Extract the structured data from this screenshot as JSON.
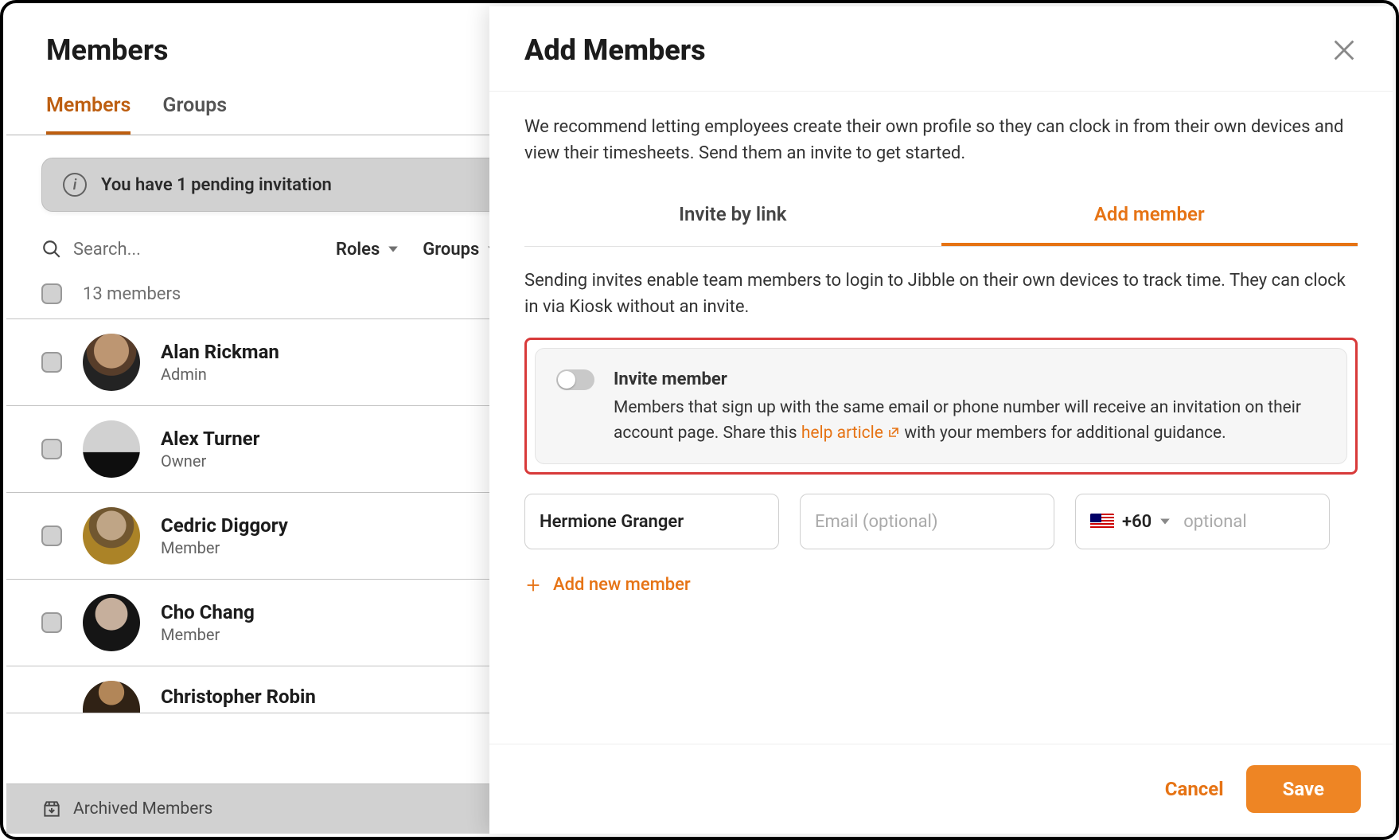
{
  "page": {
    "title": "Members"
  },
  "tabs": {
    "members": "Members",
    "groups": "Groups"
  },
  "banner": {
    "text": "You have 1 pending invitation"
  },
  "search": {
    "placeholder": "Search..."
  },
  "filters": {
    "roles": "Roles",
    "groups": "Groups"
  },
  "list": {
    "count_label": "13 members",
    "rows": [
      {
        "name": "Alan Rickman",
        "role": "Admin"
      },
      {
        "name": "Alex Turner",
        "role": "Owner"
      },
      {
        "name": "Cedric Diggory",
        "role": "Member"
      },
      {
        "name": "Cho Chang",
        "role": "Member"
      },
      {
        "name": "Christopher Robin",
        "role": ""
      }
    ]
  },
  "footer": {
    "archived": "Archived Members"
  },
  "modal": {
    "title": "Add Members",
    "intro": "We recommend letting employees create their own profile so they can clock in from their own devices and view their timesheets. Send them an invite to get started.",
    "tabs": {
      "link": "Invite by link",
      "add": "Add member"
    },
    "sub_desc": "Sending invites enable team members to login to Jibble on their own devices to track time. They can clock in via Kiosk without an invite.",
    "toggle": {
      "title": "Invite member",
      "desc_pre": "Members that sign up with the same email or phone number will receive an invitation on their account page. Share this ",
      "link": "help article",
      "desc_post": " with your members for additional guidance."
    },
    "fields": {
      "name_value": "Hermione Granger",
      "email_placeholder": "Email  (optional)",
      "phone_prefix": "+60",
      "phone_placeholder": "optional"
    },
    "add_row": "Add new member",
    "buttons": {
      "cancel": "Cancel",
      "save": "Save"
    }
  }
}
